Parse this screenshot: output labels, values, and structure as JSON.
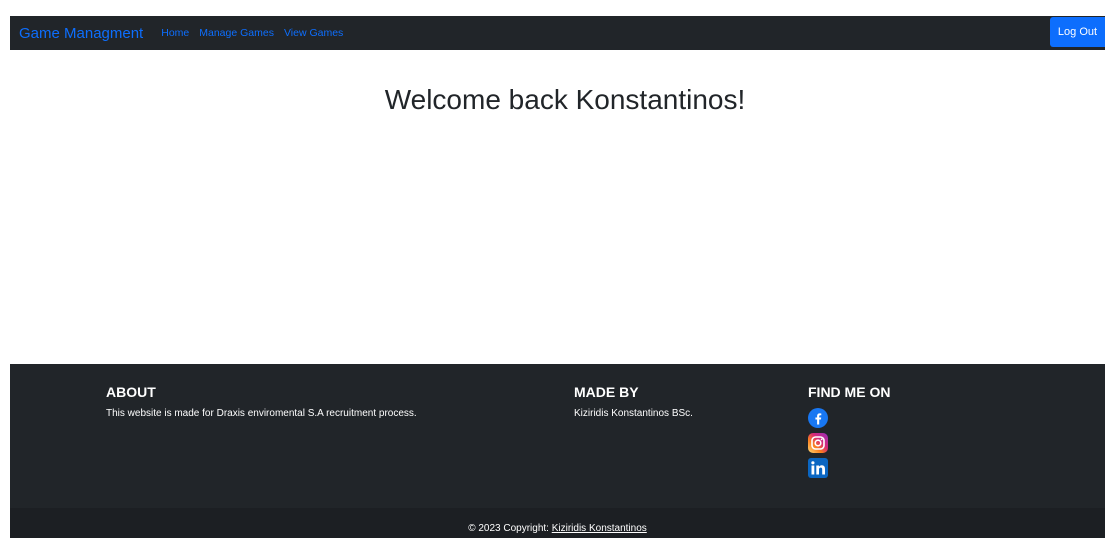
{
  "navbar": {
    "brand": "Game Managment",
    "links": [
      "Home",
      "Manage Games",
      "View Games"
    ],
    "logout_label": "Log Out"
  },
  "main": {
    "welcome": "Welcome back Konstantinos!"
  },
  "footer": {
    "about": {
      "heading": "ABOUT",
      "text": "This website is made for Draxis enviromental S.A recruitment process."
    },
    "made_by": {
      "heading": "MADE BY",
      "text": "Kiziridis Konstantinos BSc."
    },
    "find_me": {
      "heading": "FIND ME ON",
      "icons": [
        "facebook-icon",
        "instagram-icon",
        "linkedin-icon"
      ]
    },
    "copyright": {
      "prefix": "© 2023 Copyright: ",
      "link": "Kiziridis Konstantinos"
    }
  },
  "colors": {
    "navbar_bg": "#212529",
    "accent": "#0d6efd",
    "footer_bg": "#212529",
    "copyright_bg": "#1c1f23"
  }
}
